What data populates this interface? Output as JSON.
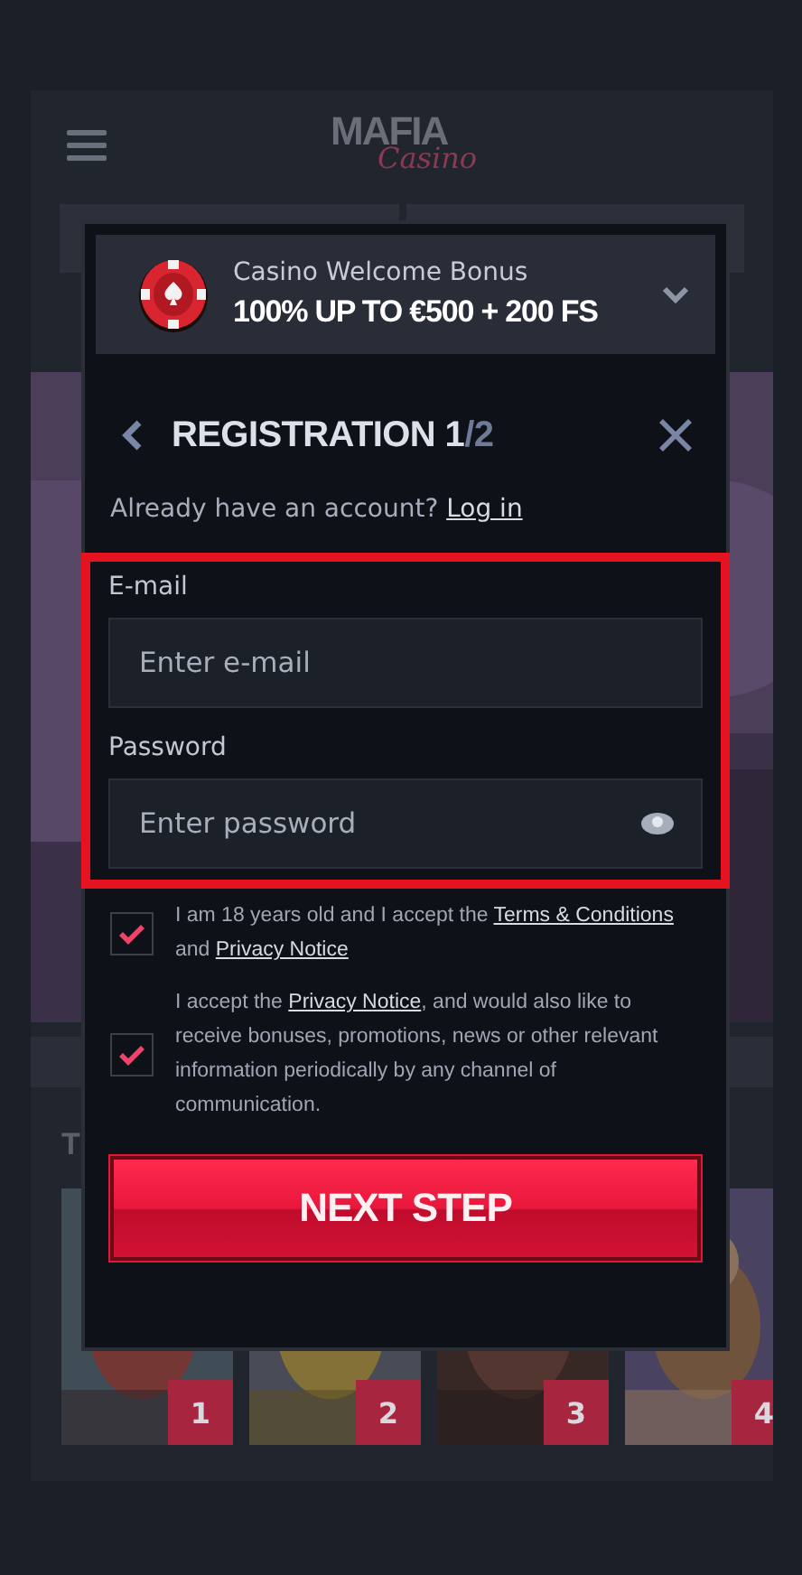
{
  "header": {
    "logo": {
      "main": "MAFIA",
      "script": "Casino"
    }
  },
  "section_heading": "T",
  "games": [
    {
      "rank": "1",
      "kind": "picture"
    },
    {
      "rank": "2",
      "kind": "picture"
    },
    {
      "rank": "3",
      "kind": "picture"
    },
    {
      "rank": "4",
      "kind": "picture"
    }
  ],
  "bonus": {
    "label": "Casino Welcome Bonus",
    "amount": "100% UP TO €500 + 200 FS",
    "expanded": false
  },
  "registration": {
    "title": "REGISTRATION",
    "step_current": "1",
    "step_total": "/2"
  },
  "account_prompt": {
    "text": "Already have an account? ",
    "link": "Log in"
  },
  "fields": [
    {
      "label": "E-mail",
      "placeholder": "Enter e-mail",
      "kind": "email"
    },
    {
      "label": "Password",
      "placeholder": "Enter password",
      "kind": "password"
    }
  ],
  "consents": [
    {
      "checked": true,
      "parts": [
        {
          "text": "I am 18 years old and I accept the "
        },
        {
          "link": "Terms & Conditions"
        },
        {
          "text": " and "
        },
        {
          "link": "Privacy Notice"
        }
      ]
    },
    {
      "checked": true,
      "parts": [
        {
          "text": "I accept the "
        },
        {
          "link": "Privacy Notice"
        },
        {
          "text": ", and would also like to receive bonuses, promotions, news or other relevant information periodically by any channel of communication."
        }
      ]
    }
  ],
  "submit": "NEXT STEP"
}
